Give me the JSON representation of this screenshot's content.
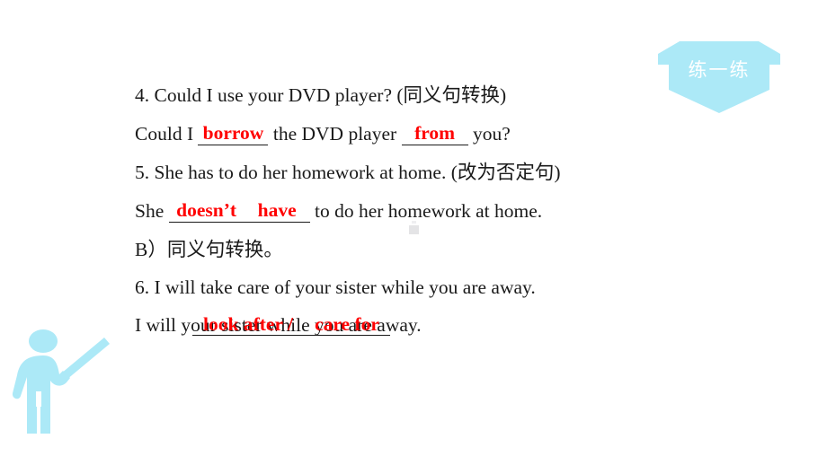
{
  "slide": {
    "background_color": "#ffffff",
    "accent_color": "#ace9f7",
    "answer_color": "#ff0000",
    "text_color": "#1a1a1a"
  },
  "banner": {
    "label": "练一练",
    "shape": "ribbon-banner",
    "fill": "#ace9f7",
    "text_color": "#ffffff"
  },
  "decoration": {
    "figure_name": "teacher-pointing-icon",
    "fill": "#ace9f7"
  },
  "exercises": {
    "items": [
      {
        "prompt": "4. Could I use your DVD player? (同义句转换)",
        "answer_line": {
          "pre": "Could I ",
          "blank1": "borrow",
          "mid": " the DVD player ",
          "blank2": "from",
          "post": " you?"
        }
      },
      {
        "prompt": "5. She has to do her homework at home. (改为否定句)",
        "answer_line": {
          "pre": "She ",
          "blank1": "doesn’t",
          "blank2": "have",
          "post": " to do her homework at home."
        }
      }
    ],
    "section_heading": "B）同义句转换。",
    "items_b": [
      {
        "prompt": "6. I will take care of your sister while you are away.",
        "answer_line": {
          "pre": "I will ",
          "blank1": "look after /",
          "blank2": "care for",
          "post": "your sister while you are away."
        }
      }
    ]
  }
}
